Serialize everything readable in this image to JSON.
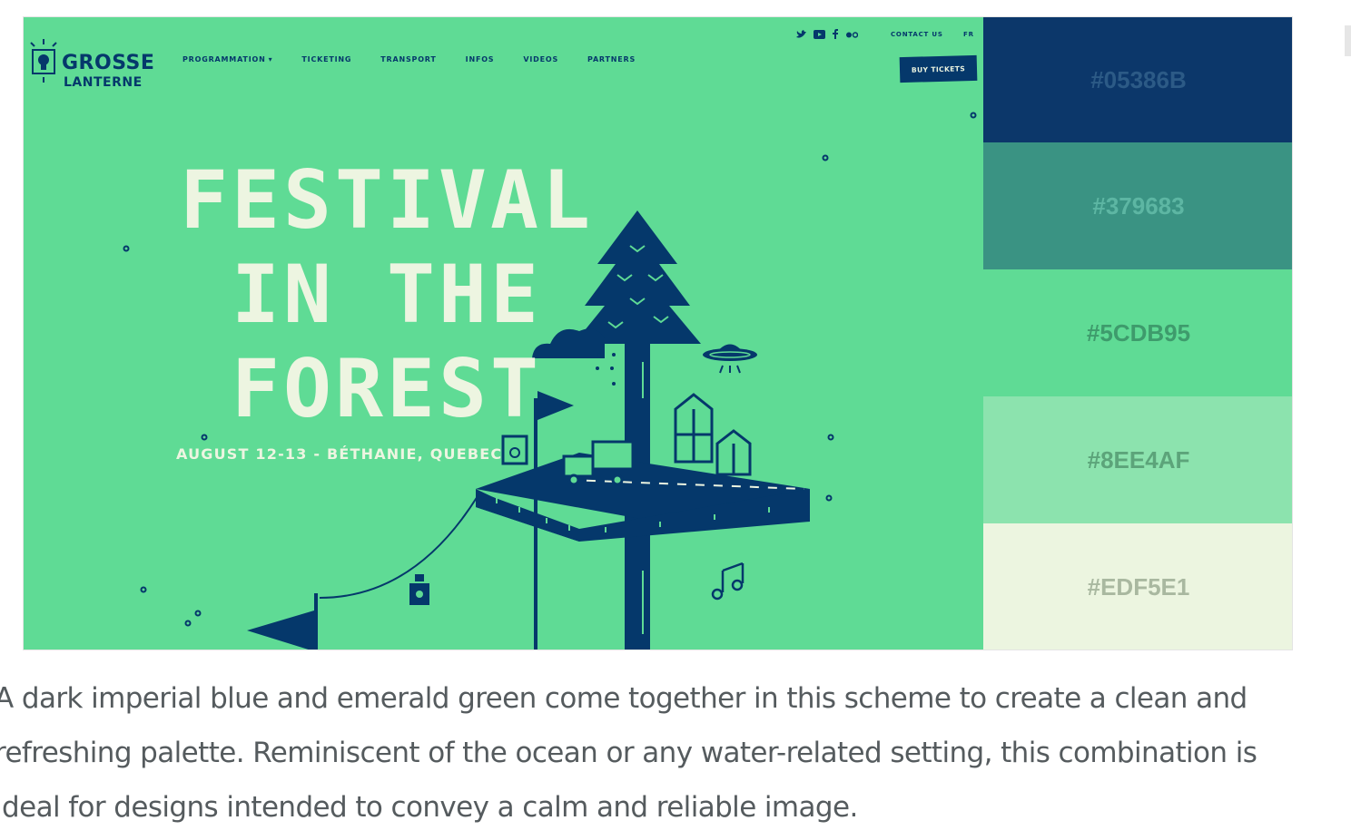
{
  "site": {
    "logo_line1": "GROSSE",
    "logo_line2": "LANTERNE",
    "nav": [
      {
        "label": "PROGRAMMATION"
      },
      {
        "label": "TICKETING"
      },
      {
        "label": "TRANSPORT"
      },
      {
        "label": "INFOS"
      },
      {
        "label": "VIDEOS"
      },
      {
        "label": "PARTNERS"
      }
    ],
    "contact_label": "CONTACT US",
    "lang_label": "FR",
    "buy_label": "BUY TICKETS",
    "headline_line1": "FESTIVAL",
    "headline_line2": "IN THE",
    "headline_line3": "FOREST",
    "date_line": "AUGUST 12-13 - BÉTHANIE, QUEBEC",
    "social_icons": [
      "twitter-icon",
      "youtube-icon",
      "facebook-icon",
      "flickr-icon"
    ]
  },
  "palette": [
    {
      "hex": "#05386B",
      "bg": "#0c376a",
      "fg": "#2c5a86"
    },
    {
      "hex": "#379683",
      "bg": "#3a9383",
      "fg": "#5db6a3"
    },
    {
      "hex": "#5CDB95",
      "bg": "#5fdb95",
      "fg": "#3e9b6c"
    },
    {
      "hex": "#8EE4AF",
      "bg": "#8ce3ae",
      "fg": "#5ca47a"
    },
    {
      "hex": "#EDF5E1",
      "bg": "#ecf5e0",
      "fg": "#a9b8a0"
    }
  ],
  "caption": "A dark imperial blue and emerald green come together in this scheme to create a clean and refreshing palette. Reminiscent of the ocean or any water-related setting, this combination is ideal for designs intended to convey a calm and reliable image."
}
